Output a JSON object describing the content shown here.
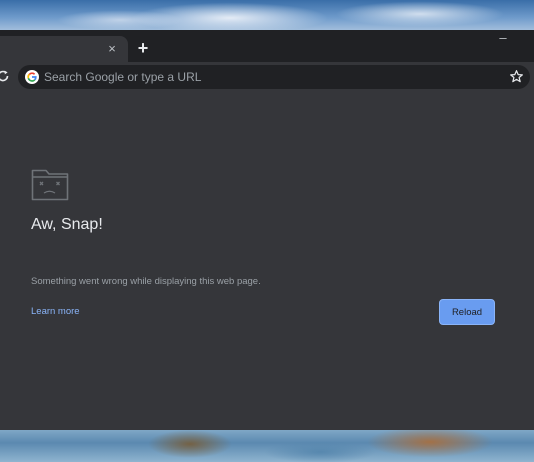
{
  "browser": {
    "tab": {
      "close_symbol": "×"
    },
    "new_tab_symbol": "+",
    "window_controls": {
      "minimize_symbol": "–"
    },
    "omnibox": {
      "placeholder": "Search Google or type a URL",
      "icons": [
        "google-icon",
        "bookmark-star-icon"
      ]
    }
  },
  "error_page": {
    "icon": "sad-folder-icon",
    "headline": "Aw, Snap!",
    "message": "Something went wrong while displaying this web page.",
    "learn_more_label": "Learn more",
    "reload_label": "Reload"
  },
  "colors": {
    "frame": "#202124",
    "toolbar": "#35363a",
    "page_background": "#35363a",
    "accent": "#8ab4f8",
    "headline_text": "#e8eaed",
    "secondary_text": "#9aa0a6"
  }
}
